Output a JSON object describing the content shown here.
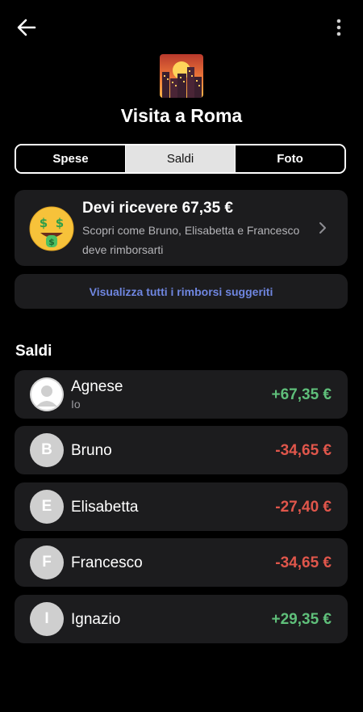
{
  "header": {
    "title": "Visita a Roma"
  },
  "tabs": [
    {
      "label": "Spese",
      "active": false
    },
    {
      "label": "Saldi",
      "active": true
    },
    {
      "label": "Foto",
      "active": false
    }
  ],
  "summary": {
    "title": "Devi ricevere 67,35 €",
    "description": "Scopri come Bruno, Elisabetta e Francesco deve rimborsarti"
  },
  "reimbursements": {
    "label": "Visualizza tutti i rimborsi suggeriti"
  },
  "balances": {
    "title": "Saldi",
    "items": [
      {
        "name": "Agnese",
        "subtitle": "Io",
        "initial": "",
        "amount": "+67,35 €",
        "positive": true
      },
      {
        "name": "Bruno",
        "subtitle": "",
        "initial": "B",
        "amount": "-34,65 €",
        "positive": false
      },
      {
        "name": "Elisabetta",
        "subtitle": "",
        "initial": "E",
        "amount": "-27,40 €",
        "positive": false
      },
      {
        "name": "Francesco",
        "subtitle": "",
        "initial": "F",
        "amount": "-34,65 €",
        "positive": false
      },
      {
        "name": "Ignazio",
        "subtitle": "",
        "initial": "I",
        "amount": "+29,35 €",
        "positive": true
      }
    ]
  },
  "colors": {
    "positive": "#5fbf7a",
    "negative": "#e0564b",
    "link": "#6f86e0",
    "card": "#1c1c1e"
  },
  "icons": {
    "back": "arrow-left-icon",
    "menu": "more-vertical-icon",
    "trip": "city-sunset-icon",
    "summary": "money-mouth-face-icon",
    "chevron": "chevron-right-icon",
    "avatar_default": "person-silhouette-icon"
  }
}
